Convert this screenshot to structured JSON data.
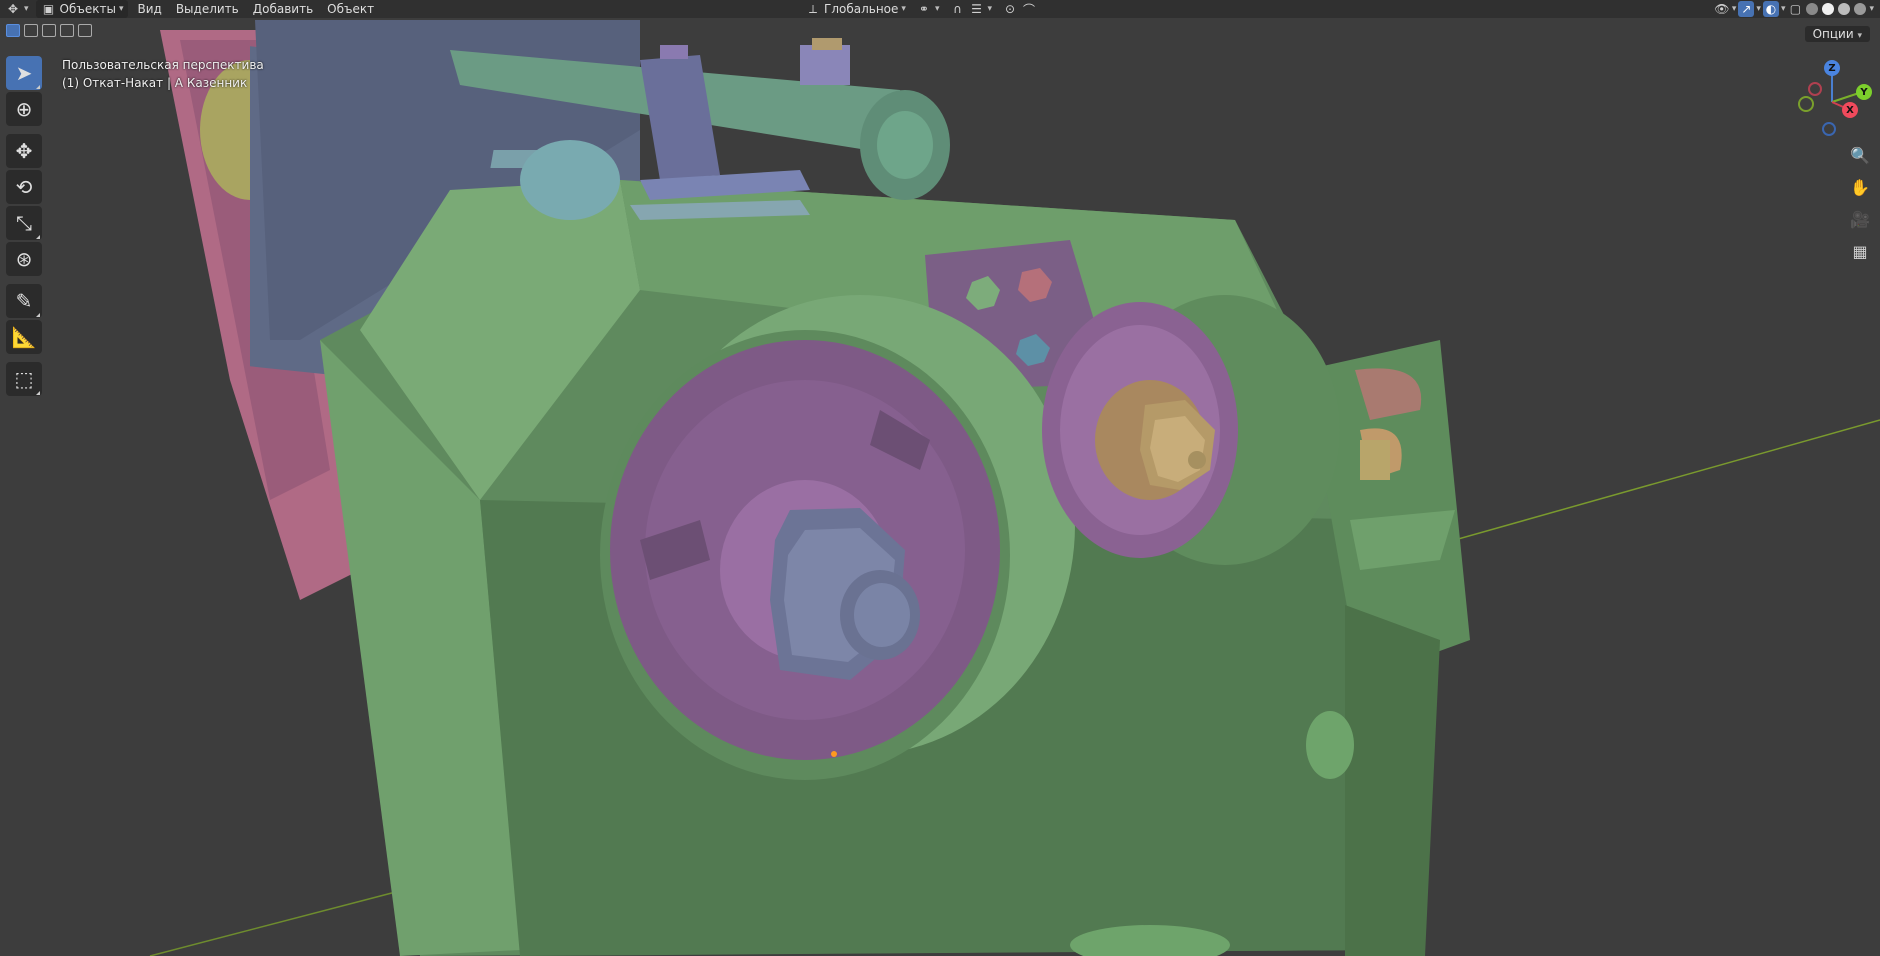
{
  "header": {
    "editor_type_icon": "editor-type-icon",
    "mode_label": "Объекты",
    "menus": [
      "Вид",
      "Выделить",
      "Добавить",
      "Объект"
    ],
    "transform_orientation": "Глобальное",
    "options_label": "Опции"
  },
  "viewport": {
    "view_name": "Пользовательская перспектива",
    "object_info": "(1) Откат-Накат | А Казенник"
  },
  "gizmo": {
    "z": "Z",
    "y": "Y",
    "x": "X"
  },
  "toolbar": {
    "tools": [
      "select-box-tool",
      "cursor-tool",
      "move-tool",
      "rotate-tool",
      "scale-tool",
      "transform-tool",
      "annotate-tool",
      "measure-tool",
      "add-cube-tool"
    ],
    "active_tool": "select-box-tool"
  },
  "colors": {
    "header_bg": "#303030",
    "viewport_bg": "#3d3d3d",
    "accent": "#4772b3",
    "body_green": "#6a9a68",
    "purple": "#7b5a82",
    "steel": "#6f7f9a"
  }
}
